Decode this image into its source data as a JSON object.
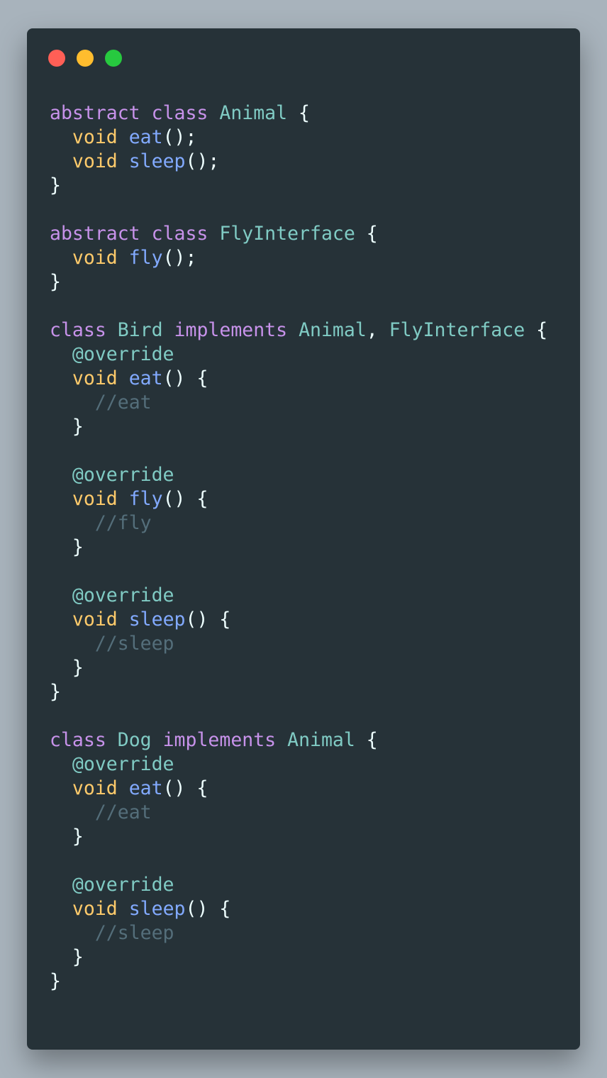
{
  "window": {
    "controls": [
      {
        "name": "close-button",
        "color": "#ff5f56"
      },
      {
        "name": "minimize-button",
        "color": "#ffbd2e"
      },
      {
        "name": "maximize-button",
        "color": "#27c93f"
      }
    ]
  },
  "code": {
    "lines": [
      [
        [
          "kw",
          "abstract"
        ],
        [
          "p",
          " "
        ],
        [
          "kw",
          "class"
        ],
        [
          "p",
          " "
        ],
        [
          "cls",
          "Animal"
        ],
        [
          "p",
          " {"
        ]
      ],
      [
        [
          "p",
          "  "
        ],
        [
          "type",
          "void"
        ],
        [
          "p",
          " "
        ],
        [
          "fn",
          "eat"
        ],
        [
          "p",
          "();"
        ]
      ],
      [
        [
          "p",
          "  "
        ],
        [
          "type",
          "void"
        ],
        [
          "p",
          " "
        ],
        [
          "fn",
          "sleep"
        ],
        [
          "p",
          "();"
        ]
      ],
      [
        [
          "p",
          "}"
        ]
      ],
      [],
      [
        [
          "kw",
          "abstract"
        ],
        [
          "p",
          " "
        ],
        [
          "kw",
          "class"
        ],
        [
          "p",
          " "
        ],
        [
          "cls",
          "FlyInterface"
        ],
        [
          "p",
          " {"
        ]
      ],
      [
        [
          "p",
          "  "
        ],
        [
          "type",
          "void"
        ],
        [
          "p",
          " "
        ],
        [
          "fn",
          "fly"
        ],
        [
          "p",
          "();"
        ]
      ],
      [
        [
          "p",
          "}"
        ]
      ],
      [],
      [
        [
          "kw",
          "class"
        ],
        [
          "p",
          " "
        ],
        [
          "cls",
          "Bird"
        ],
        [
          "p",
          " "
        ],
        [
          "kw",
          "implements"
        ],
        [
          "p",
          " "
        ],
        [
          "cls",
          "Animal"
        ],
        [
          "p",
          ", "
        ],
        [
          "cls",
          "FlyInterface"
        ],
        [
          "p",
          " {"
        ]
      ],
      [
        [
          "p",
          "  "
        ],
        [
          "ann",
          "@override"
        ]
      ],
      [
        [
          "p",
          "  "
        ],
        [
          "type",
          "void"
        ],
        [
          "p",
          " "
        ],
        [
          "fn",
          "eat"
        ],
        [
          "p",
          "() {"
        ]
      ],
      [
        [
          "p",
          "    "
        ],
        [
          "cm",
          "//eat"
        ]
      ],
      [
        [
          "p",
          "  }"
        ]
      ],
      [],
      [
        [
          "p",
          "  "
        ],
        [
          "ann",
          "@override"
        ]
      ],
      [
        [
          "p",
          "  "
        ],
        [
          "type",
          "void"
        ],
        [
          "p",
          " "
        ],
        [
          "fn",
          "fly"
        ],
        [
          "p",
          "() {"
        ]
      ],
      [
        [
          "p",
          "    "
        ],
        [
          "cm",
          "//fly"
        ]
      ],
      [
        [
          "p",
          "  }"
        ]
      ],
      [],
      [
        [
          "p",
          "  "
        ],
        [
          "ann",
          "@override"
        ]
      ],
      [
        [
          "p",
          "  "
        ],
        [
          "type",
          "void"
        ],
        [
          "p",
          " "
        ],
        [
          "fn",
          "sleep"
        ],
        [
          "p",
          "() {"
        ]
      ],
      [
        [
          "p",
          "    "
        ],
        [
          "cm",
          "//sleep"
        ]
      ],
      [
        [
          "p",
          "  }"
        ]
      ],
      [
        [
          "p",
          "}"
        ]
      ],
      [],
      [
        [
          "kw",
          "class"
        ],
        [
          "p",
          " "
        ],
        [
          "cls",
          "Dog"
        ],
        [
          "p",
          " "
        ],
        [
          "kw",
          "implements"
        ],
        [
          "p",
          " "
        ],
        [
          "cls",
          "Animal"
        ],
        [
          "p",
          " {"
        ]
      ],
      [
        [
          "p",
          "  "
        ],
        [
          "ann",
          "@override"
        ]
      ],
      [
        [
          "p",
          "  "
        ],
        [
          "type",
          "void"
        ],
        [
          "p",
          " "
        ],
        [
          "fn",
          "eat"
        ],
        [
          "p",
          "() {"
        ]
      ],
      [
        [
          "p",
          "    "
        ],
        [
          "cm",
          "//eat"
        ]
      ],
      [
        [
          "p",
          "  }"
        ]
      ],
      [],
      [
        [
          "p",
          "  "
        ],
        [
          "ann",
          "@override"
        ]
      ],
      [
        [
          "p",
          "  "
        ],
        [
          "type",
          "void"
        ],
        [
          "p",
          " "
        ],
        [
          "fn",
          "sleep"
        ],
        [
          "p",
          "() {"
        ]
      ],
      [
        [
          "p",
          "    "
        ],
        [
          "cm",
          "//sleep"
        ]
      ],
      [
        [
          "p",
          "  }"
        ]
      ],
      [
        [
          "p",
          "}"
        ]
      ]
    ]
  }
}
